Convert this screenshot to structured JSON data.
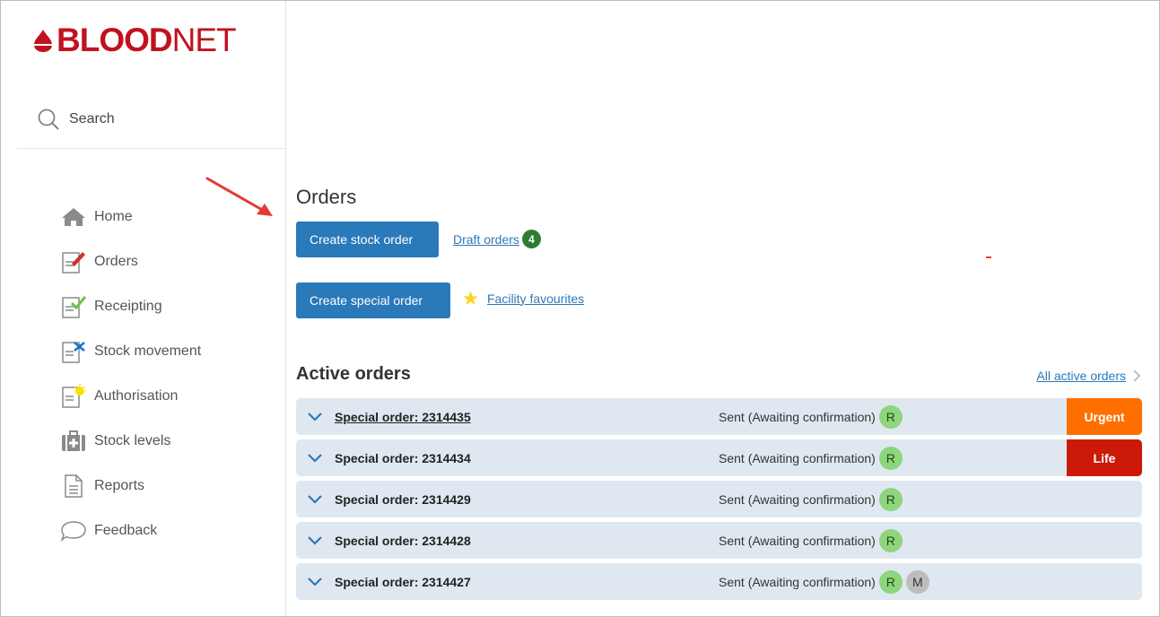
{
  "brand": {
    "logo_bold": "BLOOD",
    "logo_light": "NET",
    "color": "#c1121f"
  },
  "search": {
    "label": "Search"
  },
  "sidebar": {
    "items": [
      {
        "label": "Home",
        "icon": "home-icon"
      },
      {
        "label": "Orders",
        "icon": "orders-icon"
      },
      {
        "label": "Receipting",
        "icon": "receipting-icon"
      },
      {
        "label": "Stock movement",
        "icon": "stock-movement-icon"
      },
      {
        "label": "Authorisation",
        "icon": "authorisation-icon"
      },
      {
        "label": "Stock levels",
        "icon": "stock-levels-icon"
      },
      {
        "label": "Reports",
        "icon": "reports-icon"
      },
      {
        "label": "Feedback",
        "icon": "feedback-icon"
      }
    ]
  },
  "main": {
    "title": "Orders",
    "create_stock_label": "Create stock order",
    "draft_orders_label": "Draft orders",
    "draft_orders_count": "4",
    "create_special_label": "Create special order",
    "facility_favourites_label": "Facility favourites",
    "active_orders_title": "Active orders",
    "all_active_label": "All active orders"
  },
  "orders": [
    {
      "title": "Special order: 2314435",
      "status": "Sent (Awaiting confirmation)",
      "pills": [
        "R"
      ],
      "priority": "Urgent",
      "priority_color": "#ff6f00"
    },
    {
      "title": "Special order: 2314434",
      "status": "Sent (Awaiting confirmation)",
      "pills": [
        "R"
      ],
      "priority": "Life",
      "priority_color": "#cc1a0a"
    },
    {
      "title": "Special order: 2314429",
      "status": "Sent (Awaiting confirmation)",
      "pills": [
        "R"
      ]
    },
    {
      "title": "Special order: 2314428",
      "status": "Sent (Awaiting confirmation)",
      "pills": [
        "R"
      ]
    },
    {
      "title": "Special order: 2314427",
      "status": "Sent (Awaiting confirmation)",
      "pills": [
        "R",
        "M"
      ]
    }
  ],
  "colors": {
    "primary": "#2a79b9",
    "row_bg": "#dfe8f0",
    "badge_green": "#2f7d32",
    "pill_green": "#8fd47e",
    "pill_grey": "#bdbdbd"
  }
}
